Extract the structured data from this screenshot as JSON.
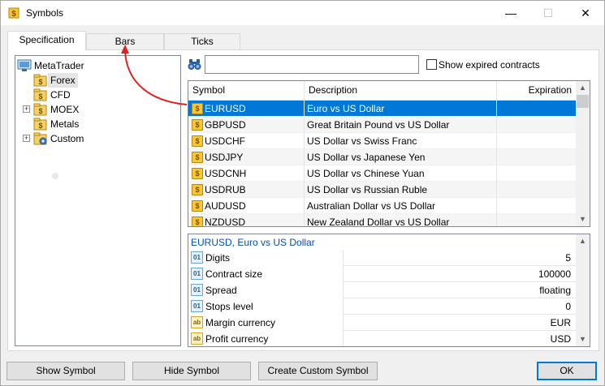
{
  "window": {
    "title": "Symbols",
    "minimize": "—",
    "maximize": "☐",
    "close": "✕"
  },
  "tabs": [
    {
      "label": "Specification",
      "active": true
    },
    {
      "label": "Bars",
      "active": false
    },
    {
      "label": "Ticks",
      "active": false
    }
  ],
  "tree": {
    "root": "MetaTrader",
    "items": [
      {
        "label": "Forex",
        "selected": true,
        "expandable": false
      },
      {
        "label": "CFD",
        "selected": false,
        "expandable": false
      },
      {
        "label": "MOEX",
        "selected": false,
        "expandable": true
      },
      {
        "label": "Metals",
        "selected": false,
        "expandable": false
      },
      {
        "label": "Custom",
        "selected": false,
        "expandable": true
      }
    ]
  },
  "search": {
    "value": "",
    "placeholder": ""
  },
  "show_expired": {
    "label": "Show expired contracts",
    "checked": false
  },
  "symbols_table": {
    "columns": [
      "Symbol",
      "Description",
      "Expiration"
    ],
    "rows": [
      {
        "symbol": "EURUSD",
        "description": "Euro vs US Dollar",
        "expiration": "",
        "selected": true
      },
      {
        "symbol": "GBPUSD",
        "description": "Great Britain Pound vs US Dollar",
        "expiration": ""
      },
      {
        "symbol": "USDCHF",
        "description": "US Dollar vs Swiss Franc",
        "expiration": ""
      },
      {
        "symbol": "USDJPY",
        "description": "US Dollar vs Japanese Yen",
        "expiration": ""
      },
      {
        "symbol": "USDCNH",
        "description": "US Dollar vs Chinese Yuan",
        "expiration": ""
      },
      {
        "symbol": "USDRUB",
        "description": "US Dollar vs Russian Ruble",
        "expiration": ""
      },
      {
        "symbol": "AUDUSD",
        "description": "Australian Dollar vs US Dollar",
        "expiration": ""
      },
      {
        "symbol": "NZDUSD",
        "description": "New Zealand Dollar vs US Dollar",
        "expiration": ""
      }
    ]
  },
  "properties": {
    "title": "EURUSD, Euro vs US Dollar",
    "rows": [
      {
        "name": "Digits",
        "value": "5",
        "icon": "numeric-icon"
      },
      {
        "name": "Contract size",
        "value": "100000",
        "icon": "numeric-icon"
      },
      {
        "name": "Spread",
        "value": "floating",
        "icon": "numeric-icon"
      },
      {
        "name": "Stops level",
        "value": "0",
        "icon": "numeric-icon"
      },
      {
        "name": "Margin currency",
        "value": "EUR",
        "icon": "text-icon"
      },
      {
        "name": "Profit currency",
        "value": "USD",
        "icon": "text-icon"
      }
    ]
  },
  "buttons": {
    "show_symbol": "Show Symbol",
    "hide_symbol": "Hide Symbol",
    "create_custom": "Create Custom Symbol",
    "ok": "OK"
  },
  "icon_glyphs": {
    "symbol": "$",
    "numeric": "01",
    "text": "ab"
  },
  "colors": {
    "selection": "#0078d7",
    "annotation_arrow": "#e02020",
    "property_title": "#0050b4"
  }
}
